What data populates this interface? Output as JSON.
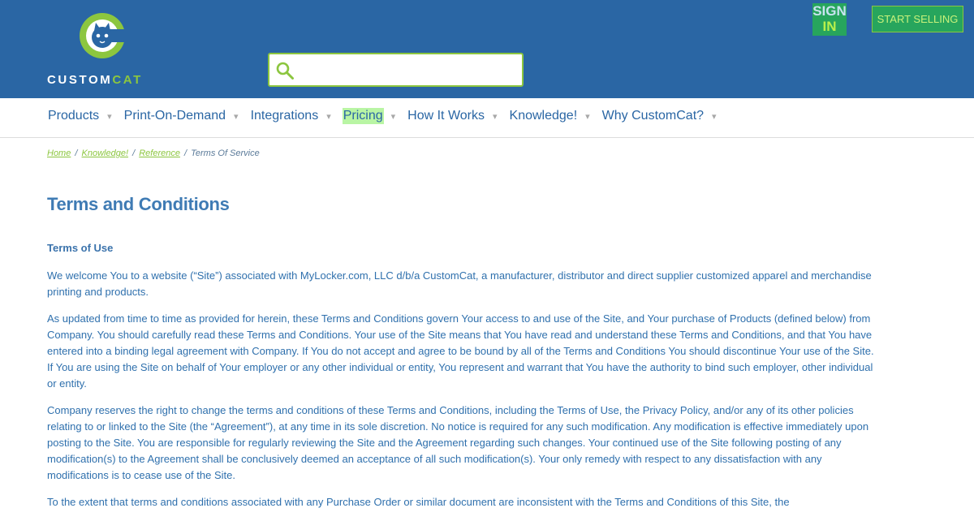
{
  "brand": {
    "word_a": "CUSTOM",
    "word_b": "CAT"
  },
  "search": {
    "placeholder": ""
  },
  "auth": {
    "sign_line1": "SIGN",
    "sign_line2": "IN",
    "start_selling": "START SELLING"
  },
  "nav": {
    "items": [
      {
        "label": "Products"
      },
      {
        "label": "Print-On-Demand"
      },
      {
        "label": "Integrations"
      },
      {
        "label": "Pricing"
      },
      {
        "label": "How It Works"
      },
      {
        "label": "Knowledge!"
      },
      {
        "label": "Why CustomCat?"
      }
    ],
    "caret": "▾"
  },
  "breadcrumb": {
    "home": "Home",
    "knowledge": "Knowledge!",
    "reference": "Reference",
    "current": "Terms Of Service",
    "separator": "/"
  },
  "page": {
    "title": "Terms and Conditions",
    "section_heading": "Terms of Use",
    "paragraphs": [
      "We welcome You to a website (“Site”) associated with MyLocker.com, LLC d/b/a CustomCat, a manufacturer, distributor and direct supplier customized apparel and merchandise printing and products.",
      "As updated from time to time as provided for herein, these Terms and Conditions govern Your access to and use of the Site, and Your purchase of Products (defined below) from Company. You should carefully read these Terms and Conditions. Your use of the Site means that You have read and understand these Terms and Conditions, and that You have entered into a binding legal agreement with Company. If You do not accept and agree to be bound by all of the Terms and Conditions You should discontinue Your use of the Site. If You are using the Site on behalf of Your employer or any other individual or entity, You represent and warrant that You have the authority to bind such employer, other individual or entity.",
      "Company reserves the right to change the terms and conditions of these Terms and Conditions, including the Terms of Use, the Privacy Policy, and/or any of its other policies relating to or linked to the Site (the “Agreement”), at any time in its sole discretion. No notice is required for any such modification. Any modification is effective immediately upon posting to the Site. You are responsible for regularly reviewing the Site and the Agreement regarding such changes. Your continued use of the Site following posting of any modification(s) to the Agreement shall be conclusively deemed an acceptance of all such modification(s). Your only remedy with respect to any dissatisfaction with any modifications is to cease use of the Site.",
      "To the extent that terms and conditions associated with any Purchase Order or similar document are inconsistent with the Terms and Conditions of this Site, the"
    ]
  },
  "colors": {
    "header_bg": "#2a66a4",
    "accent_green": "#8cc63f",
    "nav_highlight": "#b9f5a4"
  },
  "icons": {
    "logo": "cat-logo-icon",
    "search": "search-icon",
    "caret": "caret-down-icon"
  }
}
